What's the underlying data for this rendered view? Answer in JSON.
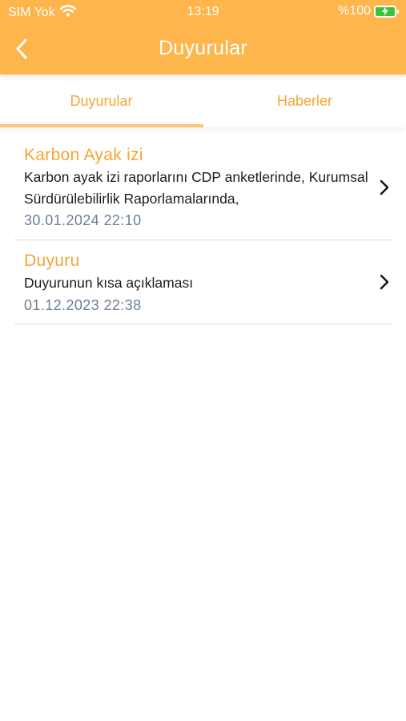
{
  "status_bar": {
    "carrier": "SIM Yok",
    "time": "13:19",
    "battery": "%100",
    "wifi_icon": "wifi-icon",
    "battery_icon": "battery-charging-icon"
  },
  "nav": {
    "title": "Duyurular",
    "back_icon": "chevron-left-icon"
  },
  "tabs": [
    {
      "label": "Duyurular",
      "active": true
    },
    {
      "label": "Haberler",
      "active": false
    }
  ],
  "announcements": [
    {
      "title": "Karbon Ayak izi",
      "description": "Karbon ayak izi raporlarını CDP anketlerinde, Kurumsal Sürdürülebilirlik Raporlamalarında,",
      "date": "30.01.2024 22:10"
    },
    {
      "title": "Duyuru",
      "description": "Duyurunun kısa açıklaması",
      "date": "01.12.2023 22:38"
    }
  ],
  "colors": {
    "header": "#FDB54C",
    "accent": "#F5A535",
    "tab_indicator": "#FCC57A",
    "date_text": "#6A7F96",
    "battery_fill": "#3CC13B"
  }
}
